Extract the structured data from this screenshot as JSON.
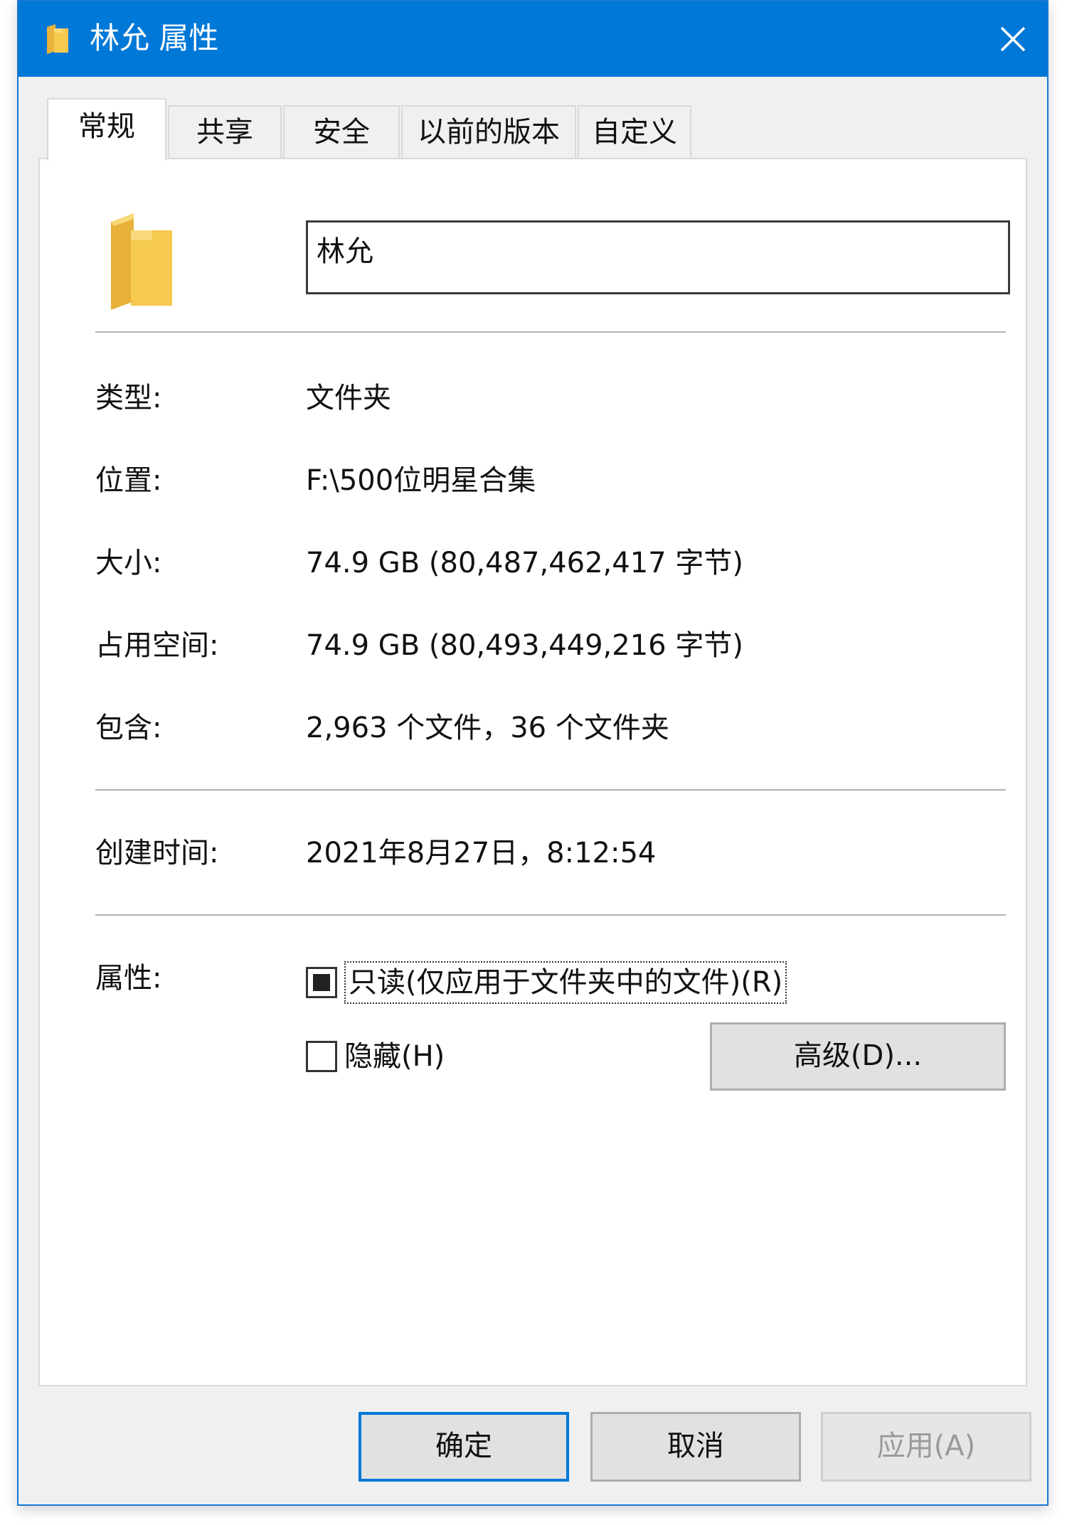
{
  "window": {
    "title": "林允 属性",
    "title_icon": "folder-icon",
    "close_icon": "close-icon"
  },
  "tabs": [
    {
      "label": "常规",
      "active": true
    },
    {
      "label": "共享",
      "active": false
    },
    {
      "label": "安全",
      "active": false
    },
    {
      "label": "以前的版本",
      "active": false
    },
    {
      "label": "自定义",
      "active": false
    }
  ],
  "general": {
    "folder_icon": "folder-icon",
    "name_value": "林允",
    "rows": [
      {
        "label": "类型:",
        "value": "文件夹"
      },
      {
        "label": "位置:",
        "value": "F:\\500位明星合集"
      },
      {
        "label": "大小:",
        "value": "74.9 GB (80,487,462,417 字节)"
      },
      {
        "label": "占用空间:",
        "value": "74.9 GB (80,493,449,216 字节)"
      },
      {
        "label": "包含:",
        "value": "2,963 个文件，36 个文件夹"
      }
    ],
    "created": {
      "label": "创建时间:",
      "value": "2021年8月27日，8:12:54"
    },
    "attributes": {
      "label": "属性:",
      "readonly_label": "只读(仅应用于文件夹中的文件)(R)",
      "readonly_state": "indeterminate",
      "hidden_label": "隐藏(H)",
      "hidden_checked": false,
      "advanced_button": "高级(D)..."
    }
  },
  "footer": {
    "ok": "确定",
    "cancel": "取消",
    "apply": "应用(A)",
    "apply_enabled": false
  },
  "colors": {
    "titlebar": "#0078d7",
    "folder": "#f3c64f",
    "default_button_border": "#0078d7"
  }
}
